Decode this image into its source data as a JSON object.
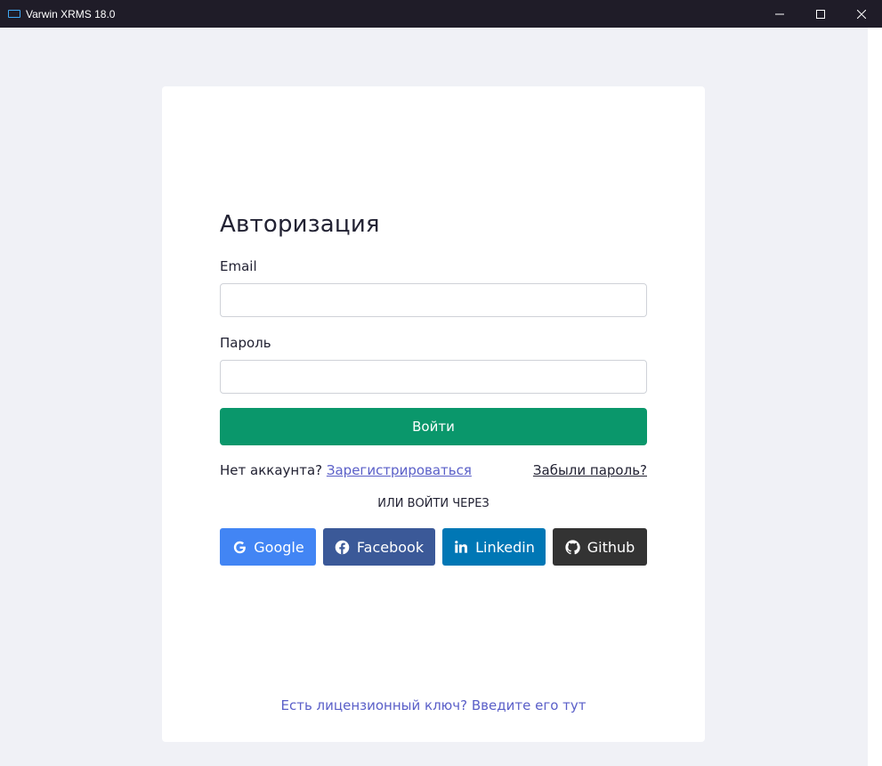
{
  "window": {
    "title": "Varwin XRMS 18.0"
  },
  "login": {
    "heading": "Авторизация",
    "email_label": "Email",
    "email_value": "",
    "password_label": "Пароль",
    "password_value": "",
    "submit_label": "Войти",
    "no_account_text": "Нет аккаунта?",
    "register_link": "Зарегистрироваться",
    "forgot_link": "Забыли пароль?",
    "or_text": "ИЛИ ВОЙТИ ЧЕРЕЗ",
    "social": [
      {
        "label": "Google",
        "icon": "google-icon",
        "color": "#4285f4"
      },
      {
        "label": "Facebook",
        "icon": "facebook-icon",
        "color": "#3b5998"
      },
      {
        "label": "Linkedin",
        "icon": "linkedin-icon",
        "color": "#0077b5"
      },
      {
        "label": "Github",
        "icon": "github-icon",
        "color": "#333333"
      }
    ],
    "license_link": "Есть лицензионный ключ? Введите его тут"
  },
  "colors": {
    "primary": "#0a976b",
    "link": "#5a5fc8",
    "titlebar": "#1f1c28",
    "background": "#f0f1f6"
  }
}
